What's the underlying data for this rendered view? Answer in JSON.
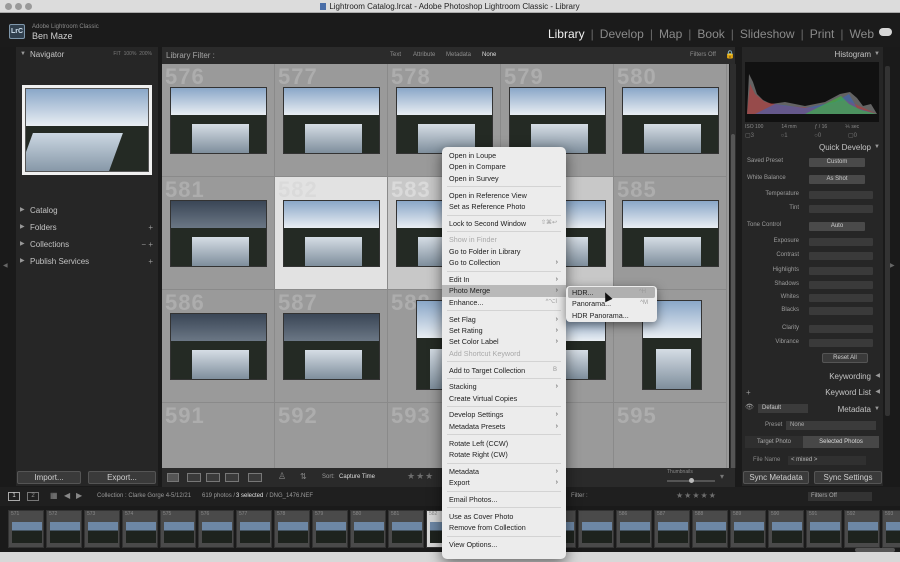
{
  "window": {
    "title": "Lightroom Catalog.lrcat - Adobe Photoshop Lightroom Classic - Library"
  },
  "identity": {
    "logo": "LrC",
    "app_name": "Adobe Lightroom Classic",
    "user_name": "Ben Maze"
  },
  "modules": {
    "items": [
      "Library",
      "Develop",
      "Map",
      "Book",
      "Slideshow",
      "Print",
      "Web"
    ],
    "active": "Library",
    "separator": "|"
  },
  "left_panel": {
    "navigator": {
      "title": "Navigator",
      "zoom_options": [
        "FIT",
        "100%",
        "200%"
      ]
    },
    "sections": [
      {
        "label": "Catalog",
        "control": ""
      },
      {
        "label": "Folders",
        "control": "+"
      },
      {
        "label": "Collections",
        "control": "− +"
      },
      {
        "label": "Publish Services",
        "control": "+"
      }
    ],
    "import_label": "Import...",
    "export_label": "Export..."
  },
  "library_filter": {
    "label": "Library Filter :",
    "options": [
      "Text",
      "Attribute",
      "Metadata",
      "None"
    ],
    "selected": "None",
    "filters_off": "Filters Off"
  },
  "grid": {
    "numbers": [
      "576",
      "577",
      "578",
      "579",
      "580",
      "581",
      "582",
      "583",
      "584",
      "585",
      "586",
      "587",
      "588",
      "589",
      "590",
      "591",
      "592",
      "593",
      "594",
      "595"
    ]
  },
  "toolbar": {
    "sort_label": "Sort:",
    "sort_value": "Capture Time",
    "thumbnails_label": "Thumbnails"
  },
  "right_panel": {
    "histogram": {
      "title": "Histogram",
      "iso": "ISO 100",
      "focal": "14 mm",
      "aperture": "ƒ / 16",
      "shutter": "⅕ sec"
    },
    "quick_develop": {
      "title": "Quick Develop",
      "saved_preset_label": "Saved Preset",
      "saved_preset_value": "Custom",
      "white_balance_label": "White Balance",
      "white_balance_value": "As Shot",
      "temperature": "Temperature",
      "tint": "Tint",
      "tone_control": "Tone Control",
      "auto": "Auto",
      "rows": [
        "Exposure",
        "Contrast",
        "Highlights",
        "Shadows",
        "Whites",
        "Blacks",
        "Clarity",
        "Vibrance"
      ],
      "reset_all": "Reset All"
    },
    "keywording": "Keywording",
    "keyword_list": "Keyword List",
    "metadata": {
      "title": "Metadata",
      "preset_dropdown": "Default",
      "preset_label": "Preset",
      "preset_value": "None",
      "target_photo": "Target Photo",
      "selected_photos": "Selected Photos",
      "file_name_label": "File Name",
      "file_name_value": "< mixed >"
    },
    "sync_metadata": "Sync Metadata",
    "sync_settings": "Sync Settings"
  },
  "bottom_bar": {
    "page1": "1",
    "page2": "2",
    "collection": "Collection : Clarke Gorge 4-5/12/21",
    "count": "619 photos /",
    "selected": "3 selected",
    "file": "/ DNG_1476.NEF",
    "filter_label": "Filter :",
    "filters_off": "Filters Off"
  },
  "filmstrip": {
    "numbers": [
      "571",
      "572",
      "573",
      "574",
      "575",
      "576",
      "577",
      "578",
      "579",
      "580",
      "581",
      "582",
      "",
      "",
      "",
      "",
      "586",
      "587",
      "588",
      "589",
      "590",
      "591",
      "592",
      "593"
    ]
  },
  "context_menu": {
    "groups": [
      [
        {
          "label": "Open in Loupe"
        },
        {
          "label": "Open in Compare"
        },
        {
          "label": "Open in Survey"
        }
      ],
      [
        {
          "label": "Open in Reference View"
        },
        {
          "label": "Set as Reference Photo"
        }
      ],
      [
        {
          "label": "Lock to Second Window",
          "shortcut": "⇧⌘↩"
        }
      ],
      [
        {
          "label": "Show in Finder",
          "disabled": true
        },
        {
          "label": "Go to Folder in Library"
        },
        {
          "label": "Go to Collection",
          "submenu": true
        }
      ],
      [
        {
          "label": "Edit In",
          "submenu": true
        },
        {
          "label": "Photo Merge",
          "submenu": true,
          "highlighted": true
        },
        {
          "label": "Enhance...",
          "shortcut": "^⌥I"
        }
      ],
      [
        {
          "label": "Set Flag",
          "submenu": true
        },
        {
          "label": "Set Rating",
          "submenu": true
        },
        {
          "label": "Set Color Label",
          "submenu": true
        },
        {
          "label": "Add Shortcut Keyword",
          "disabled": true
        }
      ],
      [
        {
          "label": "Add to Target Collection",
          "shortcut": "B"
        }
      ],
      [
        {
          "label": "Stacking",
          "submenu": true
        },
        {
          "label": "Create Virtual Copies"
        }
      ],
      [
        {
          "label": "Develop Settings",
          "submenu": true
        },
        {
          "label": "Metadata Presets",
          "submenu": true
        }
      ],
      [
        {
          "label": "Rotate Left (CCW)"
        },
        {
          "label": "Rotate Right (CW)"
        }
      ],
      [
        {
          "label": "Metadata",
          "submenu": true
        },
        {
          "label": "Export",
          "submenu": true
        }
      ],
      [
        {
          "label": "Email Photos..."
        }
      ],
      [
        {
          "label": "Use as Cover Photo"
        },
        {
          "label": "Remove from Collection"
        }
      ],
      [
        {
          "label": "View Options..."
        }
      ]
    ]
  },
  "photo_merge_submenu": [
    {
      "label": "HDR...",
      "shortcut": "^H",
      "highlighted": true
    },
    {
      "label": "Panorama...",
      "shortcut": "^M"
    },
    {
      "label": "HDR Panorama..."
    }
  ]
}
